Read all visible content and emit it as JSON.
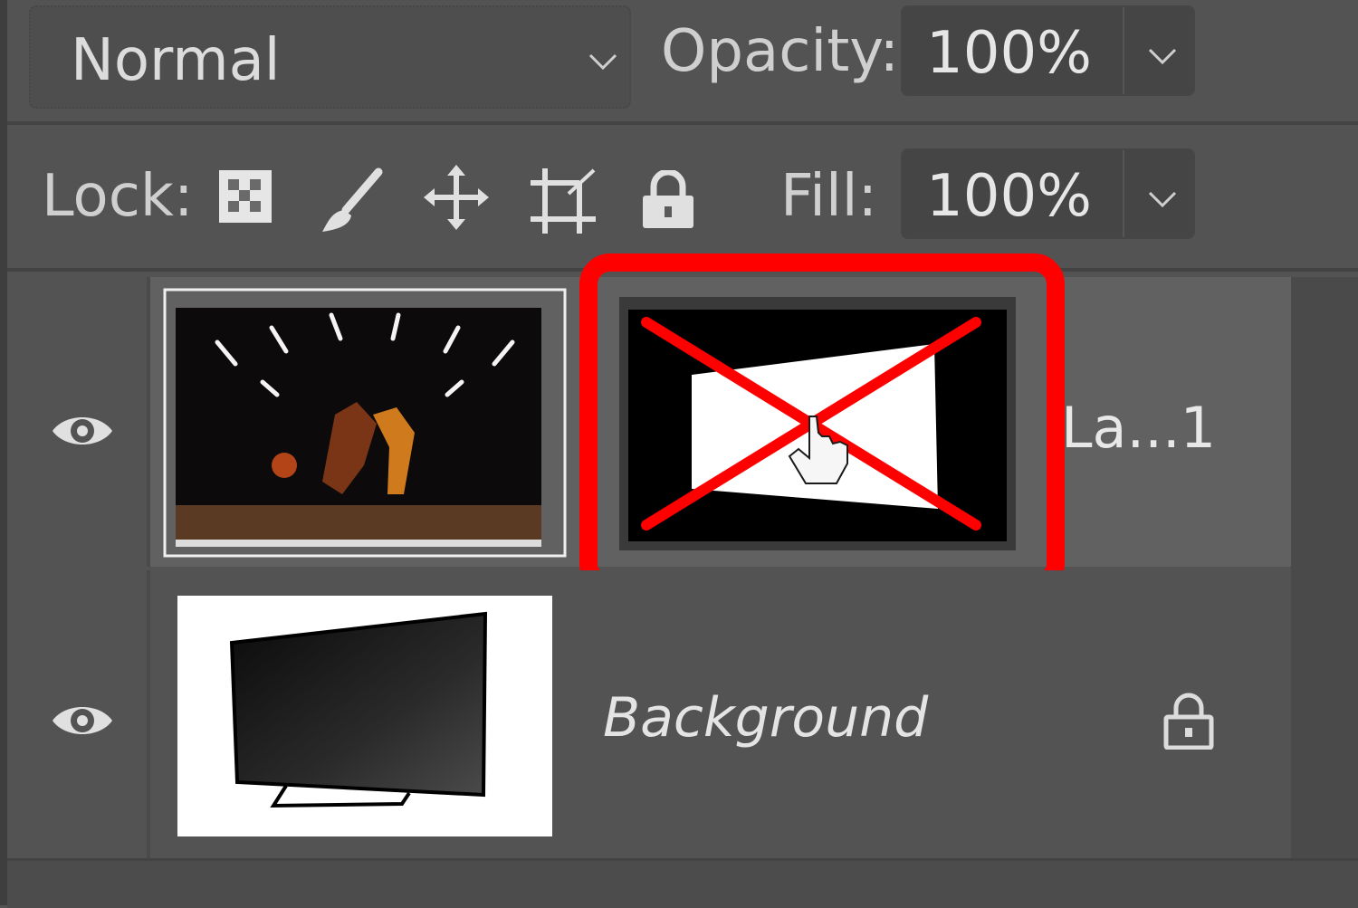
{
  "blend_mode": {
    "value": "Normal"
  },
  "opacity": {
    "label": "Opacity:",
    "value": "100%"
  },
  "lock": {
    "label": "Lock:",
    "icons": [
      "lock-transparent-pixels-icon",
      "lock-image-pixels-icon",
      "lock-position-icon",
      "lock-artboard-icon",
      "lock-all-icon"
    ]
  },
  "fill": {
    "label": "Fill:",
    "value": "100%"
  },
  "layers": [
    {
      "name": "La...1",
      "thumbnail": "basketball-players-photo",
      "mask": "layer-mask-disabled",
      "visible": true,
      "selected": true
    },
    {
      "name": "Background",
      "thumbnail": "tv-screen-image",
      "visible": true,
      "locked": true
    }
  ],
  "highlight": {
    "color": "#ff0000",
    "target": "layer-mask-thumbnail"
  },
  "colors": {
    "panel": "#535353",
    "selected_row": "#616161",
    "text": "#d6d6d6"
  }
}
